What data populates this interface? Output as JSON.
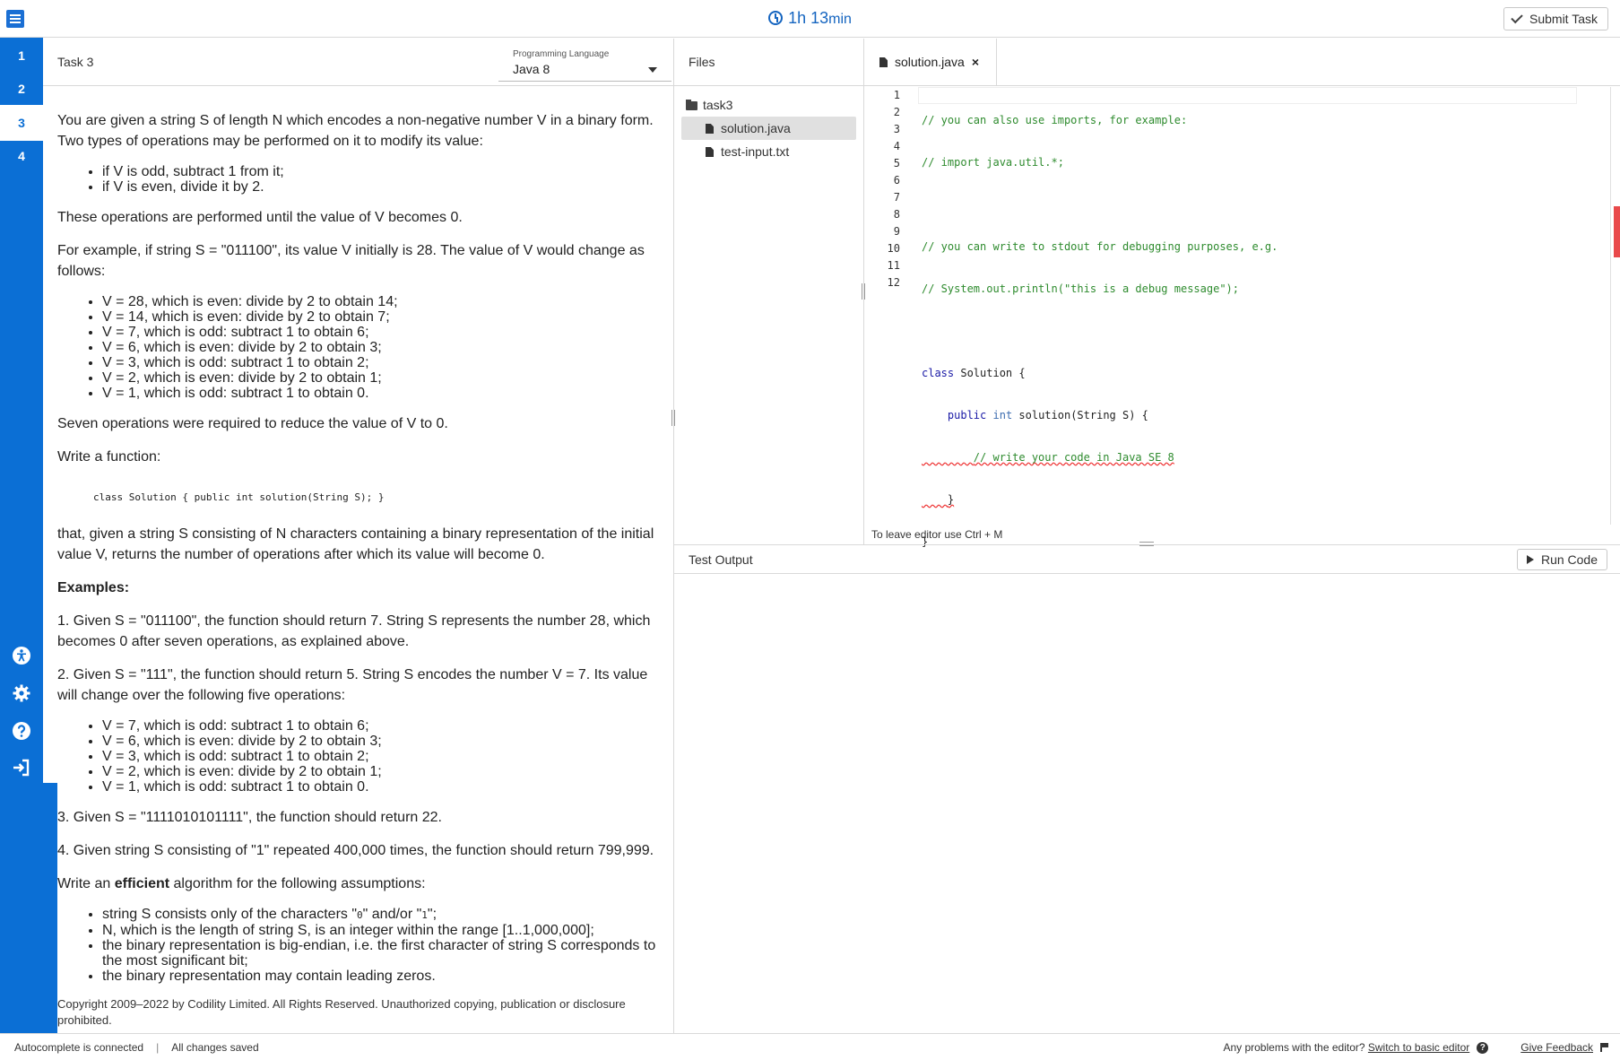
{
  "topbar": {
    "timer_value": "1h 13",
    "timer_unit": "min",
    "submit_label": "Submit Task"
  },
  "sidebar": {
    "tasks": [
      "1",
      "2",
      "3",
      "4"
    ],
    "active_task": "3",
    "bottom_icons": [
      "accessibility-icon",
      "settings-icon",
      "help-icon",
      "sign-out-icon"
    ]
  },
  "task": {
    "title": "Task 3",
    "language_label": "Programming Language",
    "language_value": "Java 8",
    "intro": "You are given a string S of length N which encodes a non-negative number V in a binary form. Two types of operations may be performed on it to modify its value:",
    "ops": [
      "if V is odd, subtract 1 from it;",
      "if V is even, divide it by 2."
    ],
    "until": "These operations are performed until the value of V becomes 0.",
    "example_intro": "For example, if string S = \"011100\", its value V initially is 28. The value of V would change as follows:",
    "example_steps": [
      "V = 28, which is even: divide by 2 to obtain 14;",
      "V = 14, which is even: divide by 2 to obtain 7;",
      "V = 7, which is odd: subtract 1 to obtain 6;",
      "V = 6, which is even: divide by 2 to obtain 3;",
      "V = 3, which is odd: subtract 1 to obtain 2;",
      "V = 2, which is even: divide by 2 to obtain 1;",
      "V = 1, which is odd: subtract 1 to obtain 0."
    ],
    "seven_ops": "Seven operations were required to reduce the value of V to 0.",
    "write_function": "Write a function:",
    "signature": "class Solution { public int solution(String S); }",
    "that_given": "that, given a string S consisting of N characters containing a binary representation of the initial value V, returns the number of operations after which its value will become 0.",
    "examples_heading": "Examples:",
    "ex1": "1. Given S = \"011100\", the function should return 7. String S represents the number 28, which becomes 0 after seven operations, as explained above.",
    "ex2": "2. Given S = \"111\", the function should return 5. String S encodes the number V = 7. Its value will change over the following five operations:",
    "ex2_steps": [
      "V = 7, which is odd: subtract 1 to obtain 6;",
      "V = 6, which is even: divide by 2 to obtain 3;",
      "V = 3, which is odd: subtract 1 to obtain 2;",
      "V = 2, which is even: divide by 2 to obtain 1;",
      "V = 1, which is odd: subtract 1 to obtain 0."
    ],
    "ex3": "3. Given S = \"1111010101111\", the function should return 22.",
    "ex4": "4. Given string S consisting of \"1\" repeated 400,000 times, the function should return 799,999.",
    "efficient_prefix": "Write an ",
    "efficient_word": "efficient",
    "efficient_suffix": " algorithm for the following assumptions:",
    "assumptions": {
      "a1_prefix": "string S consists only of the characters \"",
      "a1_zero": "0",
      "a1_mid": "\" and/or \"",
      "a1_one": "1",
      "a1_suffix": "\";",
      "a2": "N, which is the length of string S, is an integer within the range [1..1,000,000];",
      "a3": "the binary representation is big-endian, i.e. the first character of string S corresponds to the most significant bit;",
      "a4": "the binary representation may contain leading zeros."
    },
    "copyright": "Copyright 2009–2022 by Codility Limited. All Rights Reserved. Unauthorized copying, publication or disclosure prohibited."
  },
  "files": {
    "title": "Files",
    "folder": "task3",
    "items": [
      "solution.java",
      "test-input.txt"
    ],
    "selected": "solution.java"
  },
  "editor": {
    "tab_label": "solution.java",
    "line_numbers": [
      "1",
      "2",
      "3",
      "4",
      "5",
      "6",
      "7",
      "8",
      "9",
      "10",
      "11",
      "12"
    ],
    "lines": {
      "l1": "// you can also use imports, for example:",
      "l2": "// import java.util.*;",
      "l4": "// you can write to stdout for debugging purposes, e.g.",
      "l5": "// System.out.println(\"this is a debug message\");",
      "l7_kw": "class",
      "l7_rest": " Solution {",
      "l8_kw": "public",
      "l8_type": "int",
      "l8_rest": " solution(String S) {",
      "l9": "// write your code in Java SE 8",
      "l10": "}",
      "l11": "}"
    },
    "hint": "To leave editor use Ctrl + M"
  },
  "output": {
    "title": "Test Output",
    "run_label": "Run Code"
  },
  "status": {
    "autocomplete": "Autocomplete is connected",
    "saved": "All changes saved",
    "problems": "Any problems with the editor?",
    "switch_link": "Switch to basic editor",
    "feedback": "Give Feedback"
  }
}
